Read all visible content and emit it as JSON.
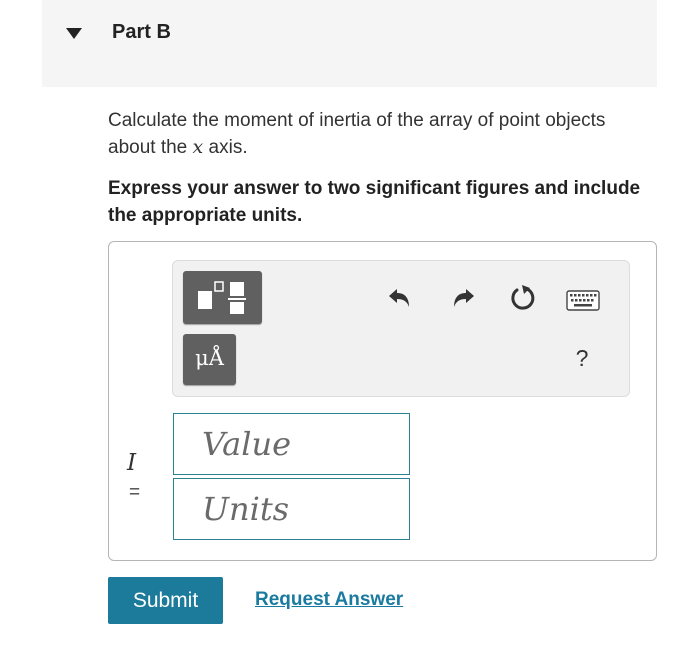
{
  "part": {
    "title": "Part B",
    "collapse_icon": "caret-down-icon"
  },
  "question": {
    "text_before": "Calculate the moment of inertia of the array of point objects about the ",
    "variable": "x",
    "text_after": " axis."
  },
  "instruction": "Express your answer to two significant figures and include the appropriate units.",
  "toolbar": {
    "template_button_icon": "templates-icon",
    "units_button_label": "μÅ",
    "undo_icon": "undo-icon",
    "redo_icon": "redo-icon",
    "reset_icon": "reset-icon",
    "keyboard_icon": "keyboard-icon",
    "help_label": "?"
  },
  "answer": {
    "variable": "I",
    "equals": "=",
    "value_placeholder": "Value",
    "units_placeholder": "Units"
  },
  "actions": {
    "submit_label": "Submit",
    "request_answer_label": "Request Answer"
  },
  "colors": {
    "header_bg": "#f5f5f5",
    "input_border": "#2b8290",
    "submit_bg": "#1c7a9a",
    "link": "#1a7aa0",
    "tool_button": "#606060"
  }
}
